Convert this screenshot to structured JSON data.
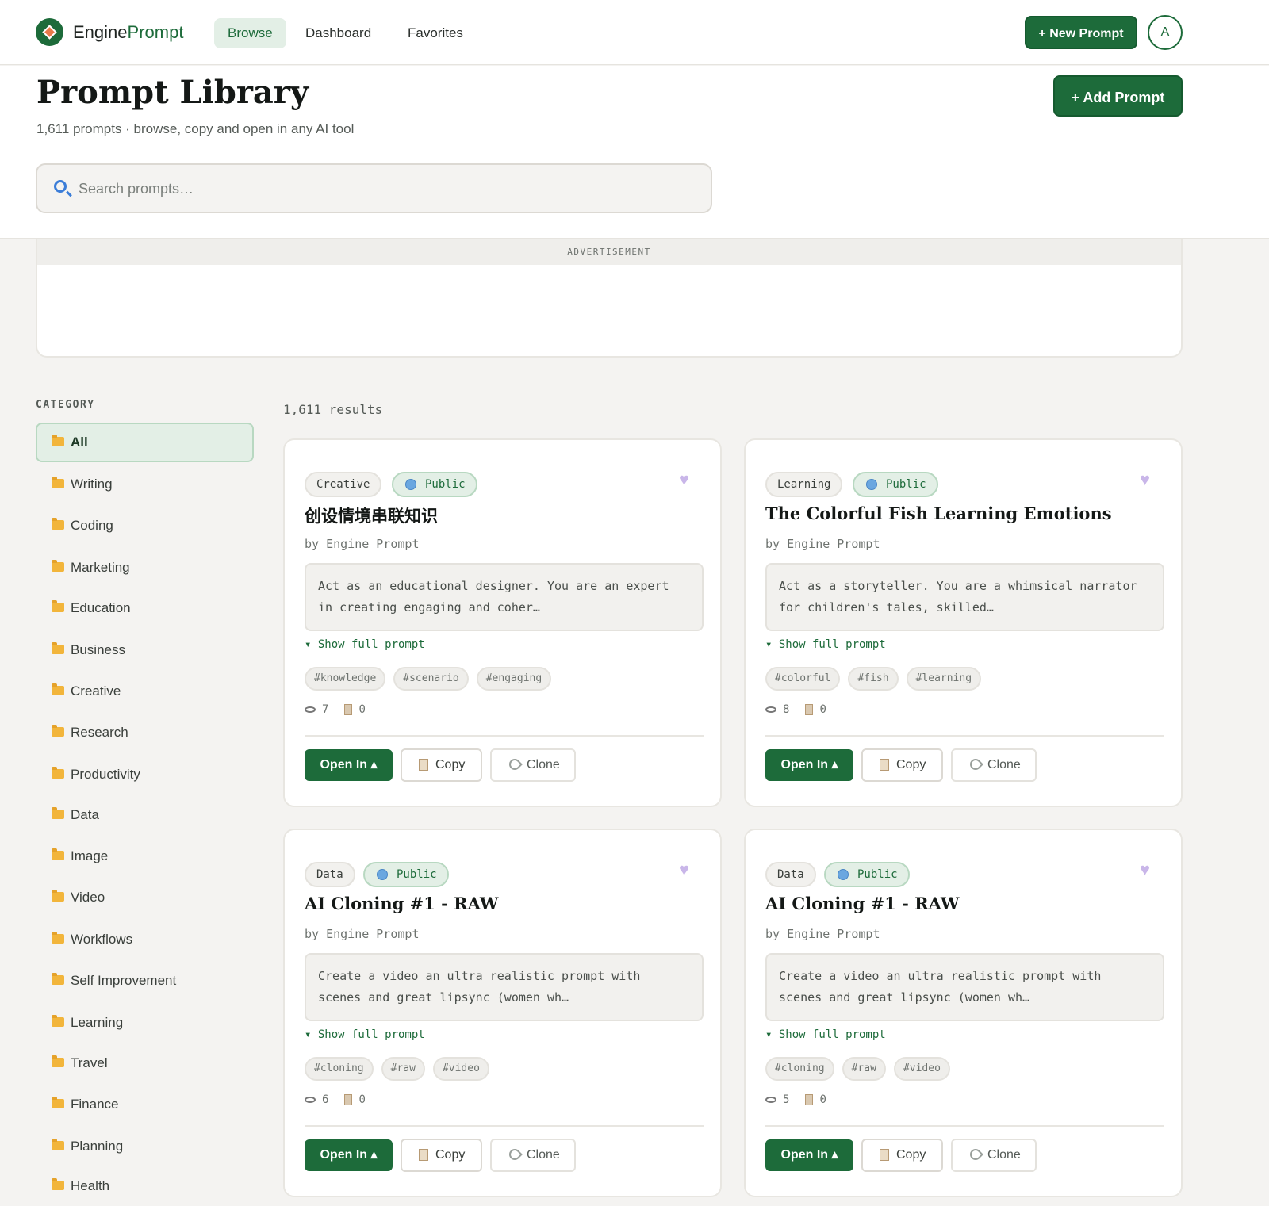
{
  "nav": {
    "brand_main": "Engine",
    "brand_accent": "Prompt",
    "links": [
      "Browse",
      "Dashboard",
      "Favorites"
    ],
    "new_prompt": "+ New Prompt",
    "avatar_initial": "A"
  },
  "header": {
    "title": "Prompt Library",
    "subtitle": "1,611 prompts · browse, copy and open in any AI tool",
    "add_prompt": "+ Add Prompt",
    "search_placeholder": "Search prompts…"
  },
  "ad": {
    "label": "ADVERTISEMENT"
  },
  "sidebar": {
    "title": "CATEGORY",
    "items": [
      "All",
      "Writing",
      "Coding",
      "Marketing",
      "Education",
      "Business",
      "Creative",
      "Research",
      "Productivity",
      "Data",
      "Image",
      "Video",
      "Workflows",
      "Self Improvement",
      "Learning",
      "Travel",
      "Finance",
      "Planning",
      "Health"
    ]
  },
  "results_count": "1,611 results",
  "cards": [
    {
      "category": "Creative",
      "visibility": "Public",
      "title": "创设情境串联知识",
      "author": "by Engine Prompt",
      "excerpt": "Act as an educational designer. You are an expert in creating engaging and coher…",
      "show_full": "▾ Show full prompt",
      "tags": [
        "#knowledge",
        "#scenario",
        "#engaging"
      ],
      "views": "7",
      "copies": "0",
      "open_label": "Open In ▴",
      "copy_label": "Copy",
      "clone_label": "Clone"
    },
    {
      "category": "Learning",
      "visibility": "Public",
      "title": "The Colorful Fish Learning Emotions",
      "author": "by Engine Prompt",
      "excerpt": "Act as a storyteller. You are a whimsical narrator for children's tales, skilled…",
      "show_full": "▾ Show full prompt",
      "tags": [
        "#colorful",
        "#fish",
        "#learning"
      ],
      "views": "8",
      "copies": "0",
      "open_label": "Open In ▴",
      "copy_label": "Copy",
      "clone_label": "Clone"
    },
    {
      "category": "Data",
      "visibility": "Public",
      "title": "AI Cloning #1 - RAW",
      "author": "by Engine Prompt",
      "excerpt": "Create a video an ultra realistic prompt with scenes and great lipsync (women wh…",
      "show_full": "▾ Show full prompt",
      "tags": [
        "#cloning",
        "#raw",
        "#video"
      ],
      "views": "6",
      "copies": "0",
      "open_label": "Open In ▴",
      "copy_label": "Copy",
      "clone_label": "Clone"
    },
    {
      "category": "Data",
      "visibility": "Public",
      "title": "AI Cloning #1 - RAW",
      "author": "by Engine Prompt",
      "excerpt": "Create a video an ultra realistic prompt with scenes and great lipsync (women wh…",
      "show_full": "▾ Show full prompt",
      "tags": [
        "#cloning",
        "#raw",
        "#video"
      ],
      "views": "5",
      "copies": "0",
      "open_label": "Open In ▴",
      "copy_label": "Copy",
      "clone_label": "Clone"
    }
  ]
}
